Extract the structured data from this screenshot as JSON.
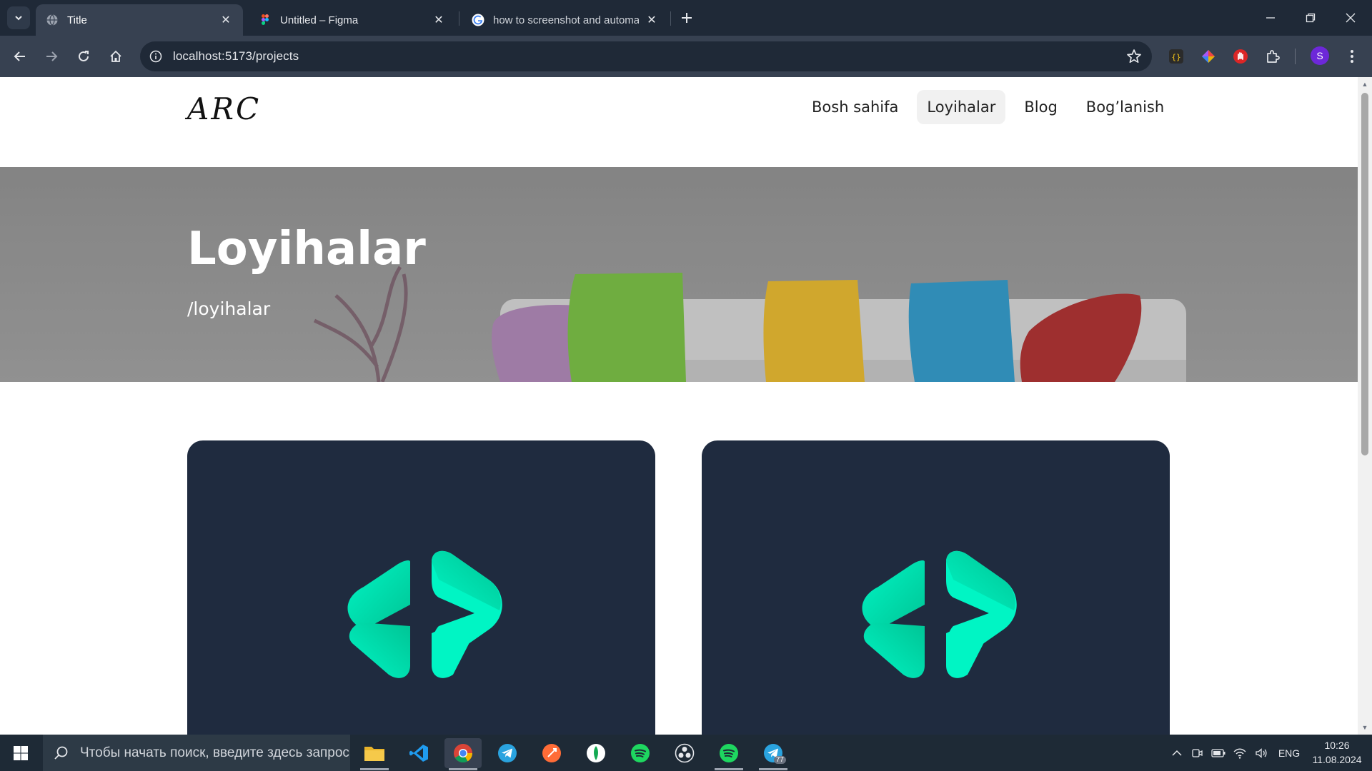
{
  "browser": {
    "tabs": [
      {
        "title": "Title",
        "active": true,
        "icon": "globe-icon"
      },
      {
        "title": "Untitled – Figma",
        "active": false,
        "icon": "figma-icon"
      },
      {
        "title": "how to screenshot and automat",
        "active": false,
        "icon": "google-icon"
      }
    ],
    "url": "localhost:5173/projects",
    "profile_initial": "S"
  },
  "site": {
    "logo": "ARC",
    "nav": [
      {
        "label": "Bosh sahifa",
        "active": false
      },
      {
        "label": "Loyihalar",
        "active": true
      },
      {
        "label": "Blog",
        "active": false
      },
      {
        "label": "Bog’lanish",
        "active": false
      }
    ],
    "hero": {
      "title": "Loyihalar",
      "subtitle": "/loyihalar"
    },
    "accent_color": "#00f5c4",
    "card_color": "#1f2b3f"
  },
  "taskbar": {
    "search_placeholder": "Чтобы начать поиск, введите здесь запрос",
    "apps": [
      "file-explorer-icon",
      "vscode-icon",
      "chrome-icon",
      "telegram-icon",
      "postman-icon",
      "mongodb-icon",
      "spotify-icon",
      "obs-icon",
      "spotify-icon",
      "telegram-icon"
    ],
    "telegram_badge": "77",
    "language": "ENG",
    "time": "10:26",
    "date": "11.08.2024"
  }
}
